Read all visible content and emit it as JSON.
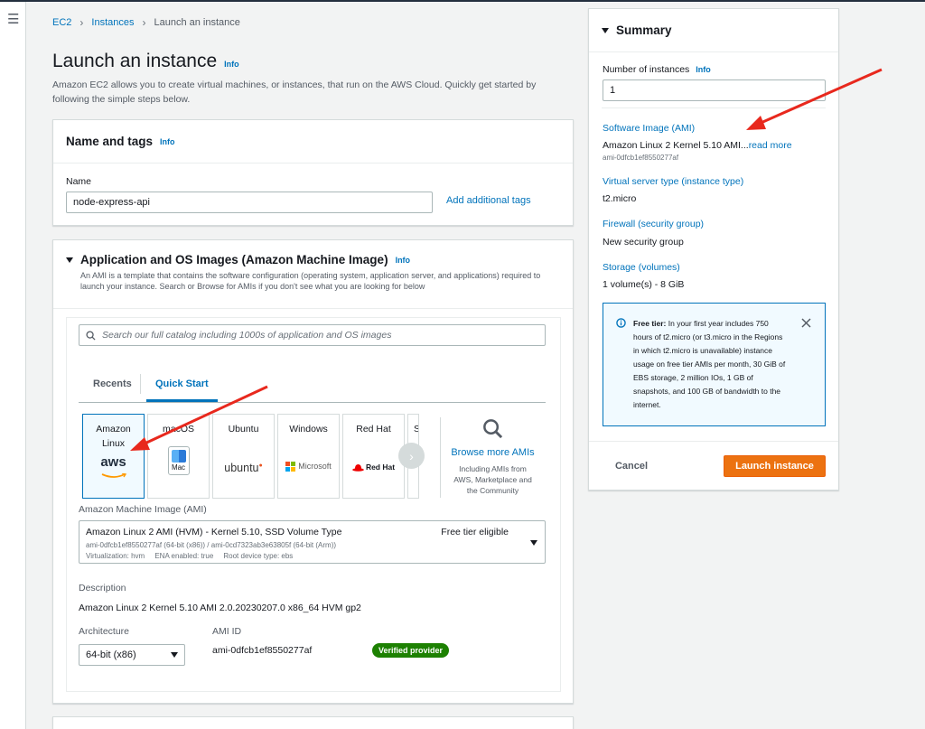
{
  "breadcrumb": [
    "EC2",
    "Instances",
    "Launch an instance"
  ],
  "page": {
    "title": "Launch an instance",
    "info": "Info",
    "description": "Amazon EC2 allows you to create virtual machines, or instances, that run on the AWS Cloud. Quickly get started by following the simple steps below."
  },
  "name_tags": {
    "title": "Name and tags",
    "info": "Info",
    "name_label": "Name",
    "name_value": "node-express-api",
    "add_tags": "Add additional tags"
  },
  "ami_section": {
    "title": "Application and OS Images (Amazon Machine Image)",
    "info": "Info",
    "description": "An AMI is a template that contains the software configuration (operating system, application server, and applications) required to launch your instance. Search or Browse for AMIs if you don't see what you are looking for below",
    "search_placeholder": "Search our full catalog including 1000s of application and OS images",
    "tabs": [
      "Recents",
      "Quick Start"
    ],
    "active_tab": "Quick Start",
    "tiles": [
      {
        "label": "Amazon Linux",
        "logo": "aws"
      },
      {
        "label": "macOS",
        "logo": "Mac"
      },
      {
        "label": "Ubuntu",
        "logo": "ubuntu"
      },
      {
        "label": "Windows",
        "logo": "Microsoft"
      },
      {
        "label": "Red Hat",
        "logo": "Red Hat"
      },
      {
        "label": "S",
        "logo": ""
      }
    ],
    "browse_more": "Browse more AMIs",
    "browse_desc": "Including AMIs from AWS, Marketplace and the Community",
    "ami_label": "Amazon Machine Image (AMI)",
    "ami_name": "Amazon Linux 2 AMI (HVM) - Kernel 5.10, SSD Volume Type",
    "free_tier": "Free tier eligible",
    "ami_ids": "ami-0dfcb1ef8550277af (64-bit (x86)) / ami-0cd7323ab3e63805f (64-bit (Arm))",
    "ami_meta": "Virtualization: hvm     ENA enabled: true     Root device type: ebs",
    "description_label": "Description",
    "description_value": "Amazon Linux 2 Kernel 5.10 AMI 2.0.20230207.0 x86_64 HVM gp2",
    "arch_label": "Architecture",
    "arch_value": "64-bit (x86)",
    "ami_id_label": "AMI ID",
    "ami_id_value": "ami-0dfcb1ef8550277af",
    "verified": "Verified provider"
  },
  "summary": {
    "title": "Summary",
    "num_label": "Number of instances",
    "num_info": "Info",
    "num_value": "1",
    "software_label": "Software Image (AMI)",
    "software_value": "Amazon Linux 2 Kernel 5.10 AMI...",
    "read_more": "read more",
    "software_id": "ami-0dfcb1ef8550277af",
    "type_label": "Virtual server type (instance type)",
    "type_value": "t2.micro",
    "firewall_label": "Firewall (security group)",
    "firewall_value": "New security group",
    "storage_label": "Storage (volumes)",
    "storage_value": "1 volume(s) - 8 GiB",
    "free_tier_title": "Free tier:",
    "free_tier_text": "In your first year includes 750 hours of t2.micro (or t3.micro in the Regions in which t2.micro is unavailable) instance usage on free tier AMIs per month, 30 GiB of EBS storage, 2 million IOs, 1 GB of snapshots, and 100 GB of bandwidth to the internet.",
    "cancel": "Cancel",
    "launch": "Launch instance"
  },
  "colors": {
    "accent_link": "#0073bb",
    "launch_button": "#ec7211",
    "verified_badge": "#1d8102",
    "annotation_arrow": "#e8281d"
  }
}
